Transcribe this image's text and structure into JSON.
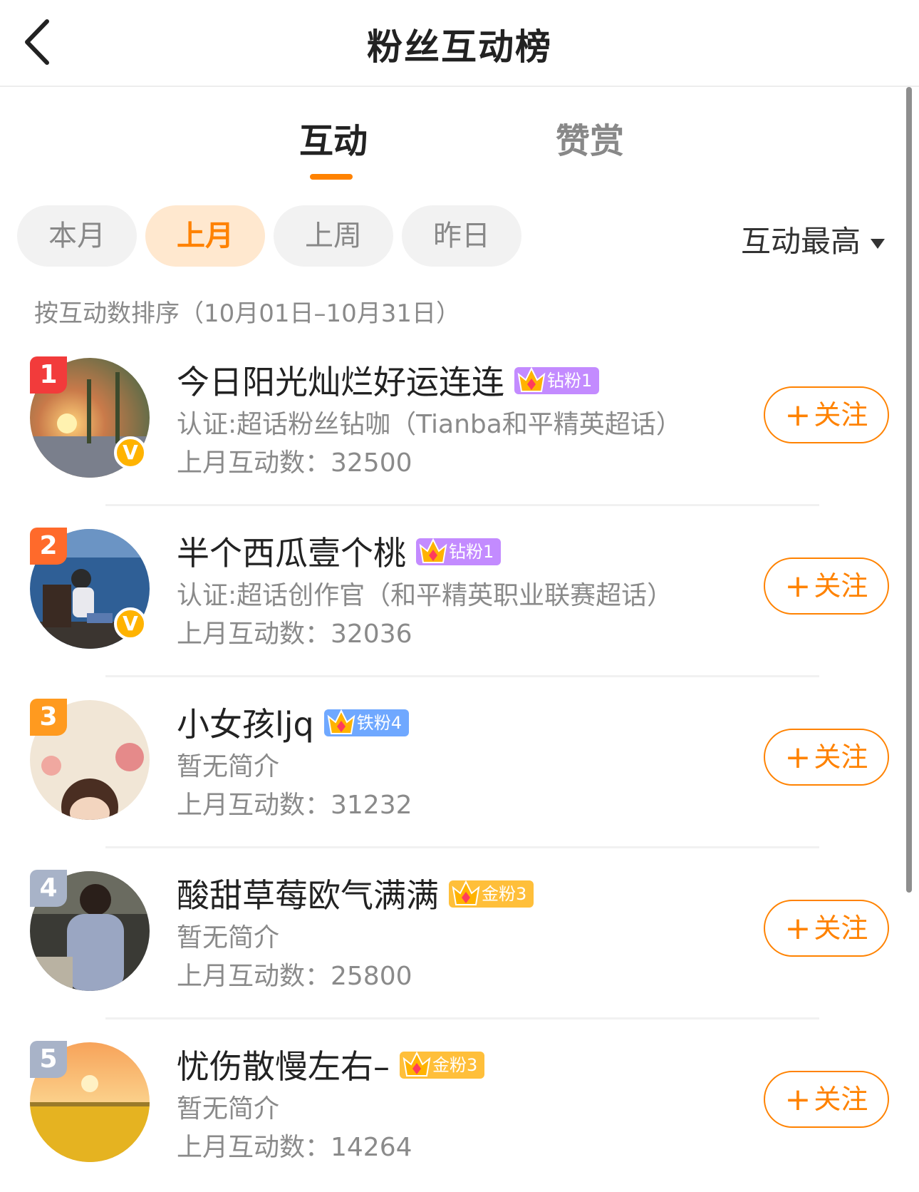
{
  "header": {
    "title": "粉丝互动榜",
    "back_icon": "chevron-left-icon"
  },
  "tabs": [
    {
      "label": "互动",
      "active": true
    },
    {
      "label": "赞赏",
      "active": false
    }
  ],
  "periods": [
    {
      "label": "本月",
      "active": false
    },
    {
      "label": "上月",
      "active": true
    },
    {
      "label": "上周",
      "active": false
    },
    {
      "label": "昨日",
      "active": false
    }
  ],
  "sort": {
    "label": "互动最高",
    "icon": "caret-down-icon"
  },
  "hint": "按互动数排序（10月01日–10月31日）",
  "colors": {
    "accent": "#ff8200",
    "rank1": "#f23b3b",
    "rank2": "#ff6a2b",
    "rank3": "#ff9a1f",
    "rankOther": "#a8b3c8"
  },
  "fans": [
    {
      "rank": "1",
      "name": "今日阳光灿烂好运连连",
      "badge": "钻粉1",
      "badge_color": "#c38bff",
      "desc": "认证:超话粉丝钻咖（Tianba和平精英超话）",
      "count": "上月互动数：32500",
      "verified": true,
      "follow": "关注"
    },
    {
      "rank": "2",
      "name": "半个西瓜壹个桃",
      "badge": "钻粉1",
      "badge_color": "#c38bff",
      "desc": "认证:超话创作官（和平精英职业联赛超话）",
      "count": "上月互动数：32036",
      "verified": true,
      "follow": "关注"
    },
    {
      "rank": "3",
      "name": "小女孩ljq",
      "badge": "铁粉4",
      "badge_color": "#6fa8ff",
      "desc": "暂无简介",
      "count": "上月互动数：31232",
      "verified": false,
      "follow": "关注"
    },
    {
      "rank": "4",
      "name": "酸甜草莓欧气满满",
      "badge": "金粉3",
      "badge_color": "#ffbf3a",
      "desc": "暂无简介",
      "count": "上月互动数：25800",
      "verified": false,
      "follow": "关注"
    },
    {
      "rank": "5",
      "name": "忧伤散慢左右–",
      "badge": "金粉3",
      "badge_color": "#ffbf3a",
      "desc": "暂无简介",
      "count": "上月互动数：14264",
      "verified": false,
      "follow": "关注"
    }
  ]
}
